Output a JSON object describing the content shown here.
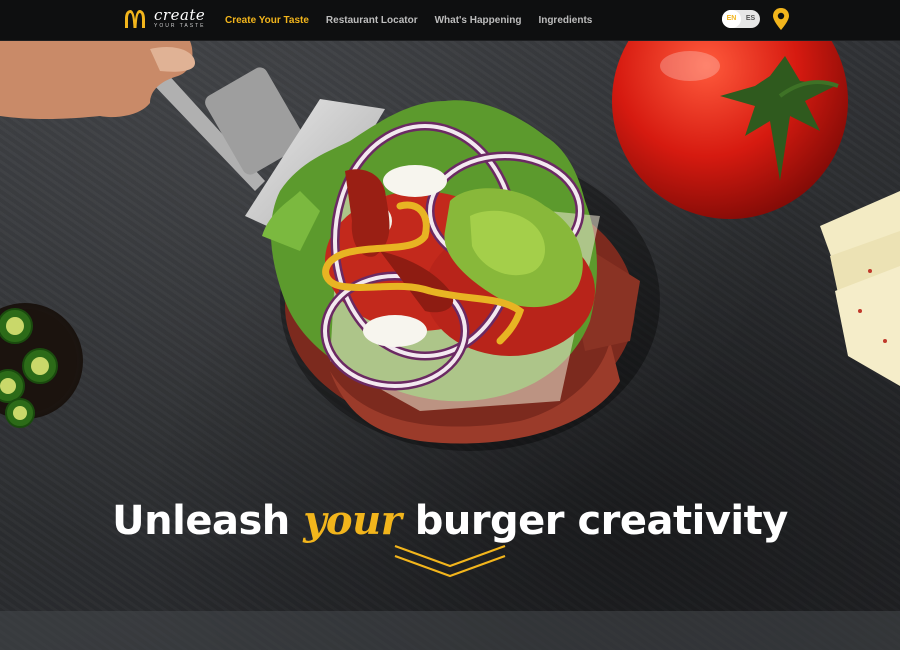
{
  "brand": {
    "wordmark": "create",
    "tagline": "YOUR TASTE"
  },
  "nav": {
    "items": [
      {
        "label": "Create Your Taste",
        "active": true
      },
      {
        "label": "Restaurant Locator",
        "active": false
      },
      {
        "label": "What's Happening",
        "active": false
      },
      {
        "label": "Ingredients",
        "active": false
      }
    ]
  },
  "language": {
    "options": [
      "EN",
      "ES"
    ],
    "selected": "EN"
  },
  "hero": {
    "headline_start": "Unleash",
    "headline_accent": "your",
    "headline_end": "burger creativity"
  },
  "icons": {
    "logo": "golden-arches-logo",
    "location": "map-pin-icon",
    "scroll": "chevron-down-icon"
  },
  "colors": {
    "accent": "#f2b51c",
    "nav_bg": "#0e0f10",
    "text_light": "#ffffff"
  }
}
